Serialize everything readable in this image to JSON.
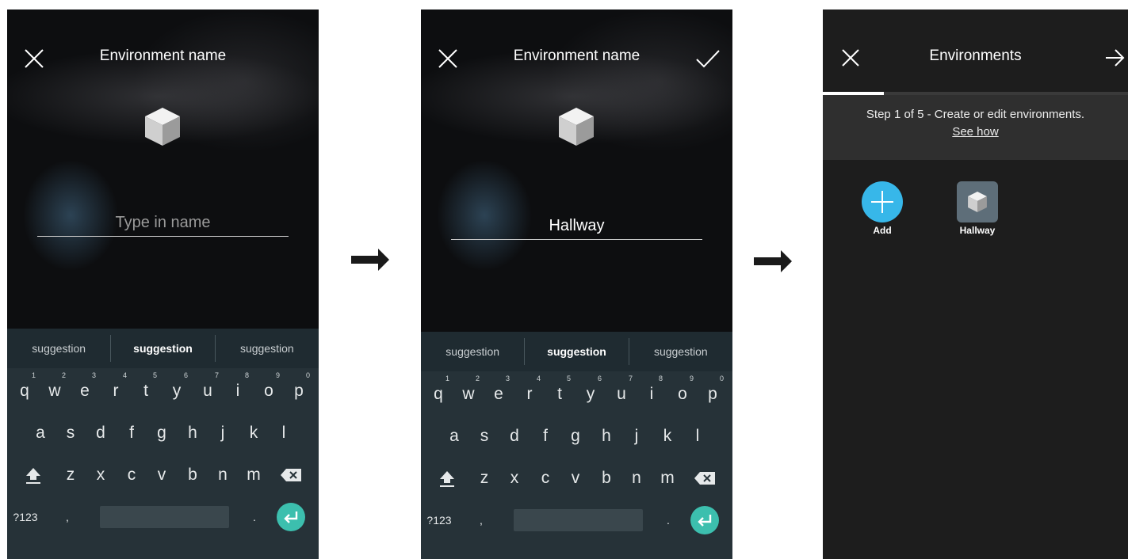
{
  "screen1": {
    "title": "Environment name",
    "name_placeholder": "Type in name",
    "icons": [
      "close-icon",
      "cube-icon"
    ]
  },
  "screen2": {
    "title": "Environment name",
    "name_value": "Hallway",
    "icons": [
      "close-icon",
      "check-icon",
      "cube-icon"
    ]
  },
  "keyboard": {
    "suggestions": [
      "suggestion",
      "suggestion",
      "suggestion"
    ],
    "row1": [
      "q",
      "w",
      "e",
      "r",
      "t",
      "y",
      "u",
      "i",
      "o",
      "p"
    ],
    "row1_sup": [
      "1",
      "2",
      "3",
      "4",
      "5",
      "6",
      "7",
      "8",
      "9",
      "0"
    ],
    "row2": [
      "a",
      "s",
      "d",
      "f",
      "g",
      "h",
      "j",
      "k",
      "l"
    ],
    "row3": [
      "z",
      "x",
      "c",
      "v",
      "b",
      "n",
      "m"
    ],
    "symbols_key": "?123",
    "comma_key": ",",
    "period_key": ".",
    "icons": [
      "shift-icon",
      "backspace-icon",
      "enter-icon"
    ]
  },
  "screen3": {
    "title": "Environments",
    "progress_fraction": 0.2,
    "step_text": "Step 1 of 5 - Create or edit environments.",
    "step_link": "See how",
    "tiles": [
      {
        "label": "Add",
        "icon": "plus-icon"
      },
      {
        "label": "Hallway",
        "icon": "cube-icon"
      }
    ],
    "icons": [
      "close-icon",
      "arrow-right-icon"
    ]
  },
  "colors": {
    "background_dark": "#0d0e10",
    "keyboard_bg": "#263238",
    "enter_key": "#3cbfae",
    "add_button": "#37b7e9",
    "environment_tile": "#5e6e79"
  }
}
